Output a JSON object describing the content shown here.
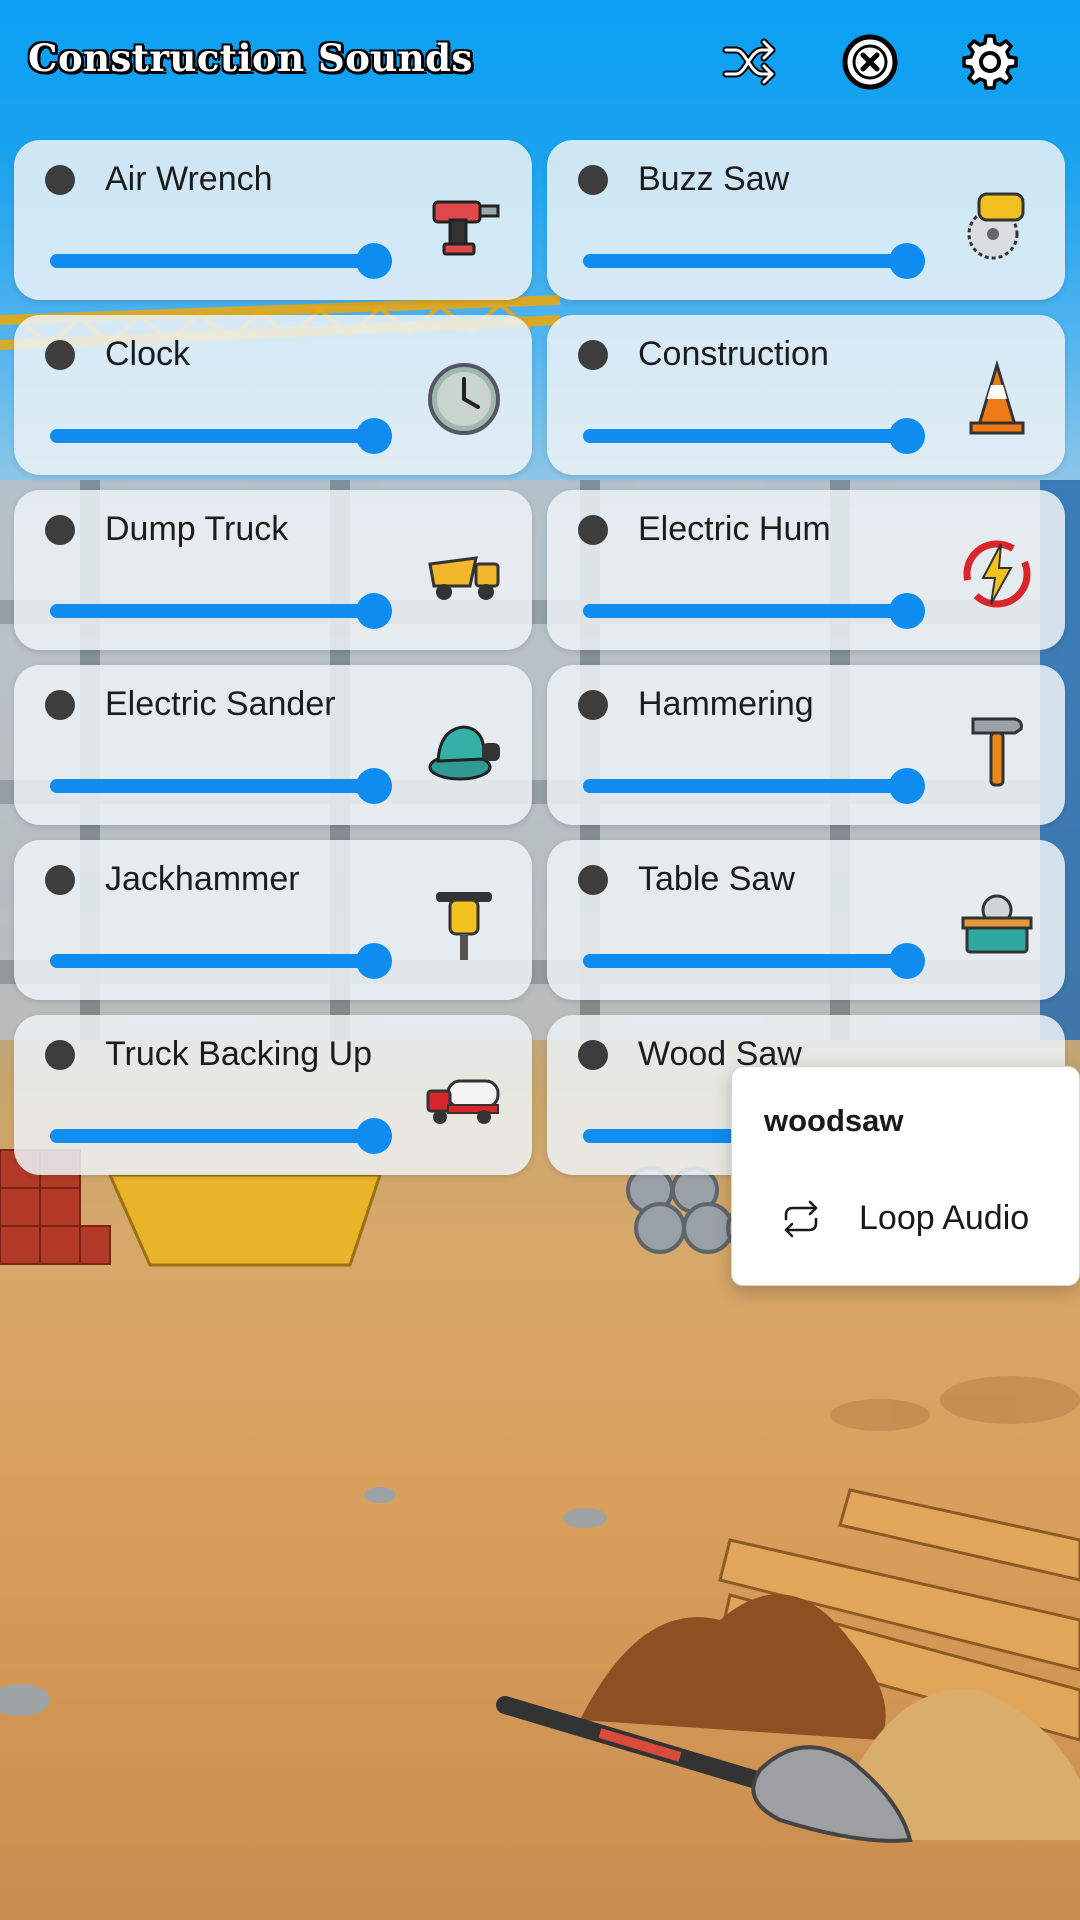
{
  "app": {
    "title": "Construction Sounds"
  },
  "header": {
    "buttons": [
      {
        "icon": "shuffle-icon"
      },
      {
        "icon": "close-circle-icon"
      },
      {
        "icon": "gear-icon"
      }
    ]
  },
  "accent_color": "#0e8cf0",
  "sounds": [
    {
      "label": "Air Wrench",
      "icon": "impact-drill-icon",
      "volume": 1.0
    },
    {
      "label": "Buzz Saw",
      "icon": "circular-saw-icon",
      "volume": 1.0
    },
    {
      "label": "Clock",
      "icon": "clock-icon",
      "volume": 1.0
    },
    {
      "label": "Construction",
      "icon": "traffic-cone-icon",
      "volume": 1.0
    },
    {
      "label": "Dump Truck",
      "icon": "dump-truck-icon",
      "volume": 1.0
    },
    {
      "label": "Electric Hum",
      "icon": "lightning-icon",
      "volume": 1.0
    },
    {
      "label": "Electric Sander",
      "icon": "sander-icon",
      "volume": 1.0
    },
    {
      "label": "Hammering",
      "icon": "hammer-icon",
      "volume": 1.0
    },
    {
      "label": "Jackhammer",
      "icon": "jackhammer-icon",
      "volume": 1.0
    },
    {
      "label": "Table Saw",
      "icon": "table-saw-icon",
      "volume": 1.0
    },
    {
      "label": "Truck Backing Up",
      "icon": "truck-icon",
      "volume": 1.0
    },
    {
      "label": "Wood Saw",
      "icon": "hand-saw-icon",
      "volume": 1.0
    }
  ],
  "context_menu": {
    "title": "woodsaw",
    "items": [
      {
        "label": "Loop Audio",
        "icon": "loop-icon"
      }
    ]
  }
}
